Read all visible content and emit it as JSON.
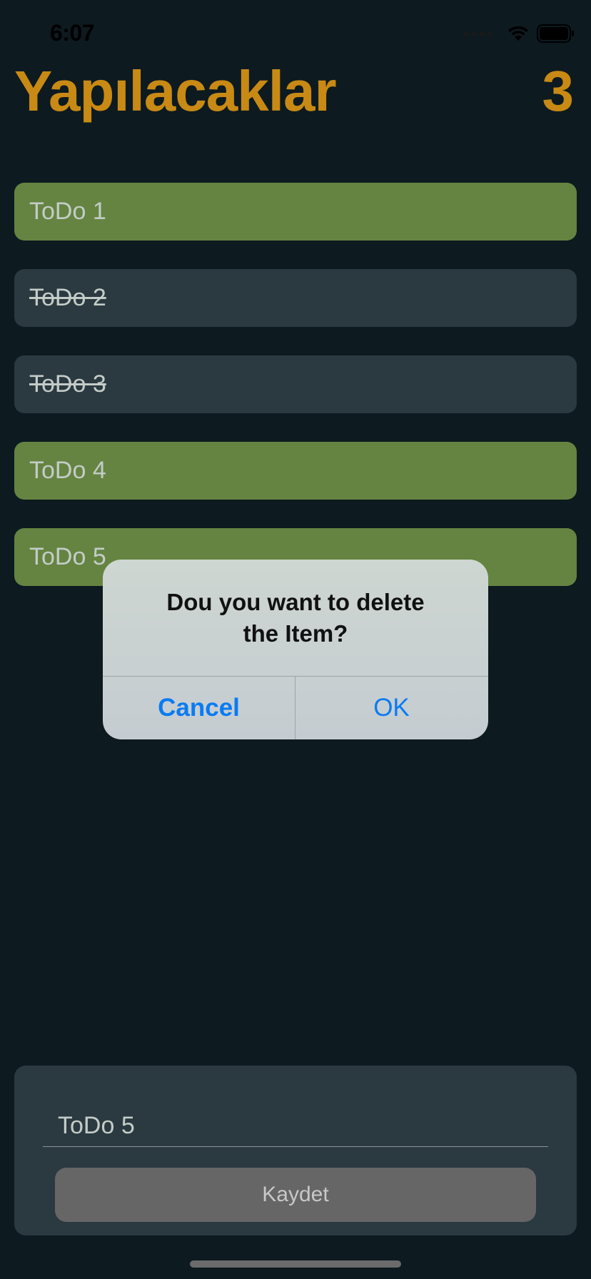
{
  "status_bar": {
    "time": "6:07"
  },
  "header": {
    "title": "Yapılacaklar",
    "count": "3",
    "accent_color": "#c88a14"
  },
  "todos": [
    {
      "label": "ToDo 1",
      "done": false
    },
    {
      "label": "ToDo 2",
      "done": true
    },
    {
      "label": "ToDo 3",
      "done": true
    },
    {
      "label": "ToDo 4",
      "done": false
    },
    {
      "label": "ToDo 5",
      "done": false
    }
  ],
  "alert": {
    "message": "Dou you want to delete the Item?",
    "cancel_label": "Cancel",
    "ok_label": "OK"
  },
  "form": {
    "input_value": "ToDo 5",
    "save_label": "Kaydet"
  },
  "colors": {
    "background": "#0d1a20",
    "active_item": "#658441",
    "done_item": "#2b3940",
    "alert_button": "#0a7bf2"
  },
  "icons": [
    "cellular-signal-icon",
    "wifi-icon",
    "battery-icon"
  ]
}
